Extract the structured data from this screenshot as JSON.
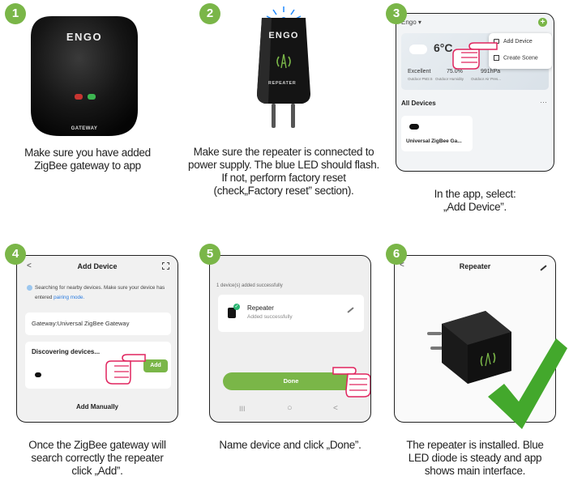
{
  "steps": [
    {
      "number": "1",
      "caption": [
        "Make sure you have added",
        "ZigBee gateway to app"
      ],
      "device_brand": "ENGO",
      "device_label": "GATEWAY"
    },
    {
      "number": "2",
      "caption": [
        "Make sure the repeater is connected to",
        "power supply. The blue LED should flash.",
        "If not, perform factory reset",
        "(check„Factory reset” section)."
      ],
      "device_brand": "ENGO",
      "device_label": "REPEATER"
    },
    {
      "number": "3",
      "caption": [
        "In the app, select:",
        "„Add Device”."
      ],
      "app": {
        "home_name": "Engo ▾",
        "temperature": "6°C",
        "weather_values": [
          "Excellent",
          "75.0%",
          "991hPa"
        ],
        "weather_labels": [
          "Outdoor PM2.5",
          "Outdoor Humidity",
          "Outdoor Air Pres..."
        ],
        "menu_add_device": "Add Device",
        "menu_create_scene": "Create Scene",
        "section_title": "All Devices",
        "more": "···",
        "device_card": "Universal ZigBee Ga..."
      }
    },
    {
      "number": "4",
      "caption": [
        "Once the ZigBee gateway will",
        "search correctly the repeater",
        "click „Add”."
      ],
      "app": {
        "back": "<",
        "title": "Add Device",
        "info_text": "Searching for nearby devices. Make sure your device has",
        "info_text_2": "entered",
        "info_link": "pairing mode.",
        "gateway_row": "Gateway:Universal ZigBee Gateway",
        "discovering": "Discovering devices...",
        "add_button": "Add",
        "add_manually": "Add Manually"
      }
    },
    {
      "number": "5",
      "caption": [
        "Name device and click „Done”."
      ],
      "app": {
        "added_count": "1 device(s) added successfully",
        "device_name": "Repeater",
        "device_status": "Added successfully",
        "done_button": "Done",
        "nav_recent": "III",
        "nav_home": "○",
        "nav_back": "<"
      }
    },
    {
      "number": "6",
      "caption": [
        "The repeater is installed. Blue",
        "LED diode is steady and app",
        "shows main interface."
      ],
      "app": {
        "back": "<",
        "title": "Repeater"
      }
    }
  ],
  "colors": {
    "accent": "#7ab648",
    "led_blue": "#1e88ff",
    "led_red": "#e53935",
    "led_green": "#43d15a",
    "device_black": "#141414"
  }
}
